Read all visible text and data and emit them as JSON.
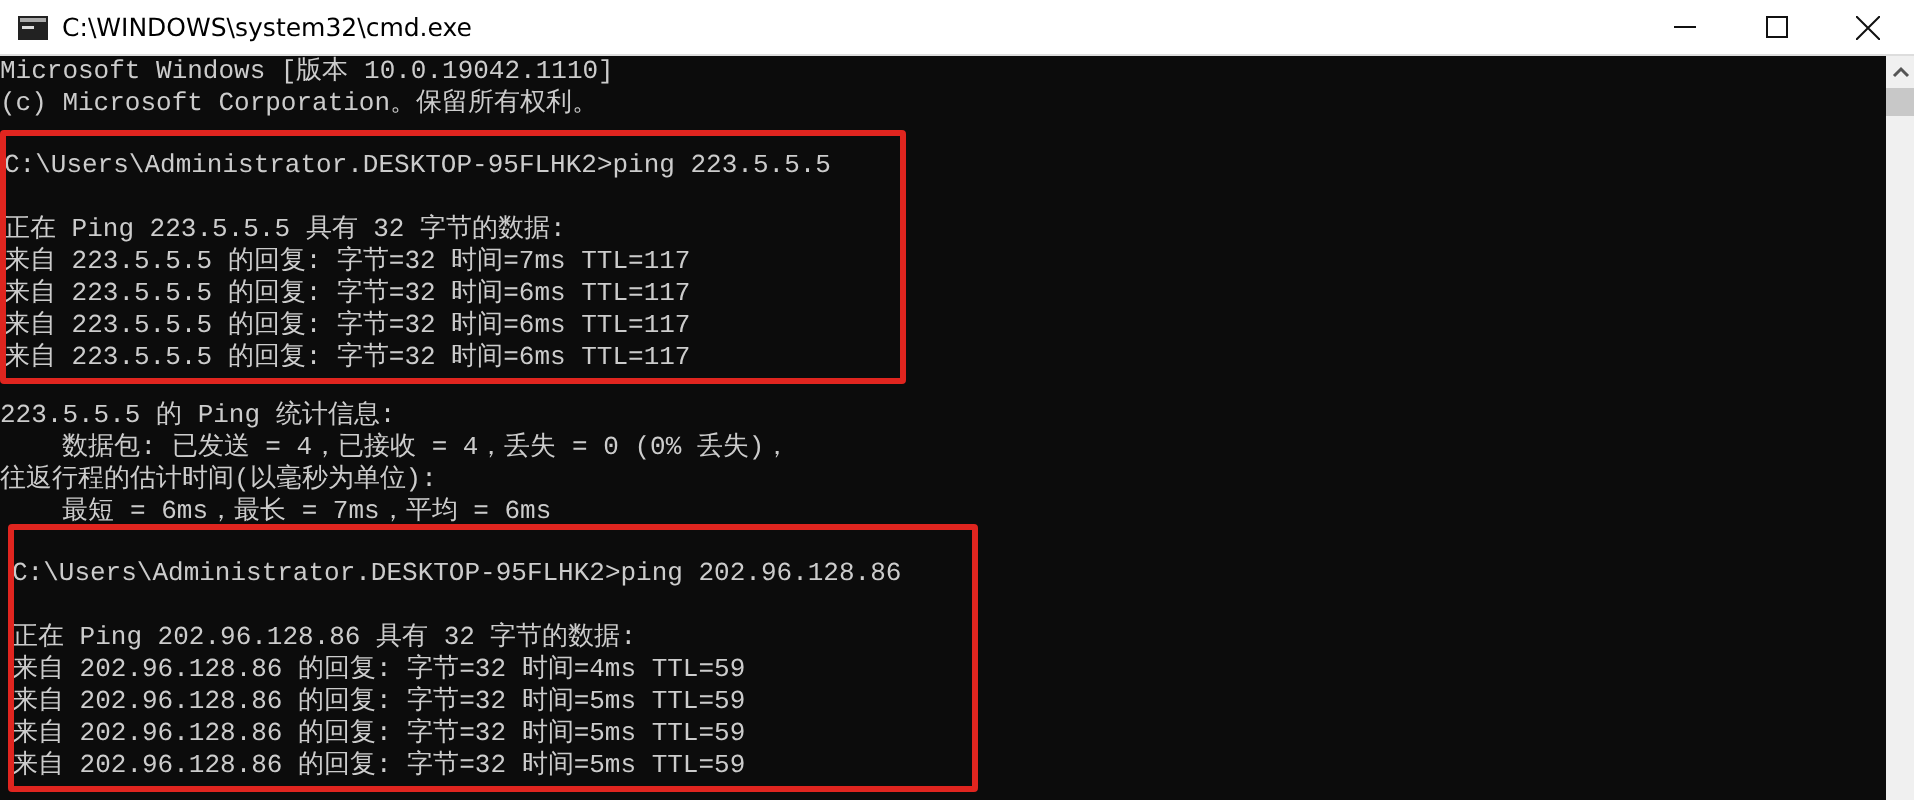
{
  "window": {
    "title": "C:\\WINDOWS\\system32\\cmd.exe",
    "controls": [
      {
        "kind": "minimize"
      },
      {
        "kind": "maximize"
      },
      {
        "kind": "close"
      }
    ]
  },
  "console": {
    "sections": [
      {
        "highlighted": false,
        "lines": [
          {
            "kind": "text",
            "text": "Microsoft Windows [版本 10.0.19042.1110]"
          },
          {
            "kind": "text",
            "text": "(c) Microsoft Corporation。保留所有权利。"
          }
        ]
      },
      {
        "highlighted": true,
        "lines": [
          {
            "kind": "text",
            "text": "C:\\Users\\Administrator.DESKTOP-95FLHK2>ping 223.5.5.5"
          },
          {
            "kind": "blank"
          },
          {
            "kind": "text",
            "text": "正在 Ping 223.5.5.5 具有 32 字节的数据:"
          },
          {
            "kind": "text",
            "text": "来自 223.5.5.5 的回复: 字节=32 时间=7ms TTL=117"
          },
          {
            "kind": "text",
            "text": "来自 223.5.5.5 的回复: 字节=32 时间=6ms TTL=117"
          },
          {
            "kind": "text",
            "text": "来自 223.5.5.5 的回复: 字节=32 时间=6ms TTL=117"
          },
          {
            "kind": "text",
            "text": "来自 223.5.5.5 的回复: 字节=32 时间=6ms TTL=117"
          }
        ]
      },
      {
        "highlighted": false,
        "lines": [
          {
            "kind": "text",
            "text": "223.5.5.5 的 Ping 统计信息:"
          },
          {
            "kind": "text",
            "text": "    数据包: 已发送 = 4，已接收 = 4，丢失 = 0 (0% 丢失)，"
          },
          {
            "kind": "text",
            "text": "往返行程的估计时间(以毫秒为单位):"
          },
          {
            "kind": "text",
            "text": "    最短 = 6ms，最长 = 7ms，平均 = 6ms"
          }
        ]
      },
      {
        "highlighted": true,
        "lines": [
          {
            "kind": "text",
            "text": "C:\\Users\\Administrator.DESKTOP-95FLHK2>ping 202.96.128.86"
          },
          {
            "kind": "blank"
          },
          {
            "kind": "text",
            "text": "正在 Ping 202.96.128.86 具有 32 字节的数据:"
          },
          {
            "kind": "text",
            "text": "来自 202.96.128.86 的回复: 字节=32 时间=4ms TTL=59"
          },
          {
            "kind": "text",
            "text": "来自 202.96.128.86 的回复: 字节=32 时间=5ms TTL=59"
          },
          {
            "kind": "text",
            "text": "来自 202.96.128.86 的回复: 字节=32 时间=5ms TTL=59"
          },
          {
            "kind": "text",
            "text": "来自 202.96.128.86 的回复: 字节=32 时间=5ms TTL=59"
          }
        ]
      }
    ]
  }
}
